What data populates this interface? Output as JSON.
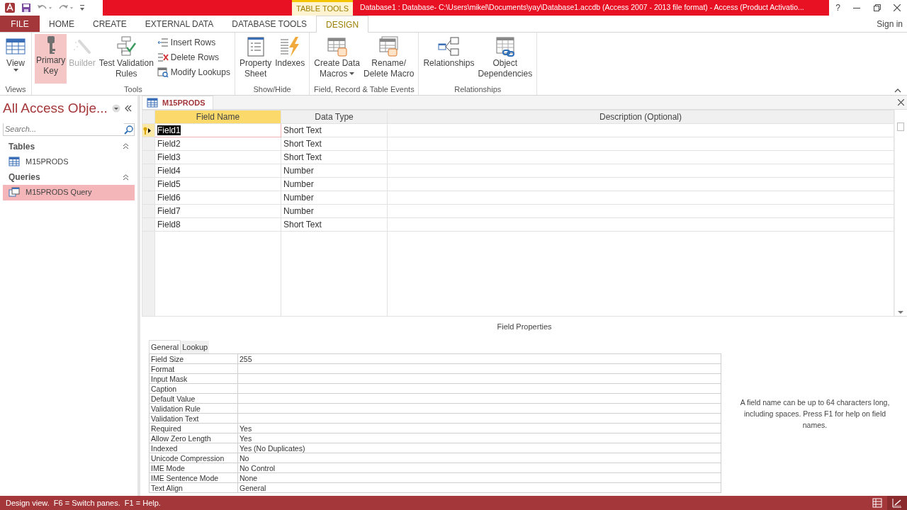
{
  "title_bar": {
    "context_tab": "TABLE TOOLS",
    "title": "Database1 : Database- C:\\Users\\mikel\\Documents\\yay\\Database1.accdb (Access 2007 - 2013 file format) -  Access (Product Activatio...",
    "help": "?"
  },
  "ribbon_tabs": [
    {
      "label": "FILE",
      "kind": "file",
      "selected": false
    },
    {
      "label": "HOME",
      "kind": "tab",
      "selected": false
    },
    {
      "label": "CREATE",
      "kind": "tab",
      "selected": false
    },
    {
      "label": "EXTERNAL DATA",
      "kind": "tab",
      "selected": false
    },
    {
      "label": "DATABASE TOOLS",
      "kind": "tab",
      "selected": false
    },
    {
      "label": "DESIGN",
      "kind": "tab",
      "selected": true
    }
  ],
  "account": "Sign in",
  "ribbon_groups": [
    {
      "label": "Views",
      "buttons": [
        {
          "kind": "large",
          "label": [
            "View"
          ],
          "dropdown": true,
          "selected": false,
          "disabled": false
        }
      ]
    },
    {
      "label": "Tools",
      "buttons": [
        {
          "kind": "large",
          "label": [
            "Primary",
            "Key"
          ],
          "dropdown": false,
          "selected": true,
          "disabled": false
        },
        {
          "kind": "large",
          "label": [
            "Builder"
          ],
          "dropdown": false,
          "selected": false,
          "disabled": true
        },
        {
          "kind": "large",
          "label": [
            "Test Validation",
            "Rules"
          ],
          "dropdown": false,
          "selected": false,
          "disabled": false
        },
        {
          "kind": "small",
          "label": [
            "Insert Rows"
          ]
        },
        {
          "kind": "small",
          "label": [
            "Delete Rows"
          ]
        },
        {
          "kind": "small",
          "label": [
            "Modify Lookups"
          ]
        }
      ]
    },
    {
      "label": "Show/Hide",
      "buttons": [
        {
          "kind": "large",
          "label": [
            "Property",
            "Sheet"
          ],
          "dropdown": false,
          "selected": false,
          "disabled": false
        },
        {
          "kind": "large",
          "label": [
            "Indexes"
          ],
          "dropdown": false,
          "selected": false,
          "disabled": false
        }
      ]
    },
    {
      "label": "Field, Record & Table Events",
      "buttons": [
        {
          "kind": "large",
          "label": [
            "Create Data",
            "Macros"
          ],
          "dropdown": true,
          "selected": false,
          "disabled": false
        },
        {
          "kind": "large",
          "label": [
            "Rename/",
            "Delete Macro"
          ],
          "dropdown": false,
          "selected": false,
          "disabled": false
        }
      ]
    },
    {
      "label": "Relationships",
      "buttons": [
        {
          "kind": "large",
          "label": [
            "Relationships"
          ],
          "dropdown": false,
          "selected": false,
          "disabled": false
        },
        {
          "kind": "large",
          "label": [
            "Object",
            "Dependencies"
          ],
          "dropdown": false,
          "selected": false,
          "disabled": false
        }
      ]
    }
  ],
  "navigation_pane": {
    "title": "All Access Obje...",
    "search": {
      "placeholder": "Search..."
    },
    "sections": [
      {
        "title": "Tables",
        "items": [
          {
            "label": "M15PRODS",
            "kind": "table",
            "selected": false
          }
        ]
      },
      {
        "title": "Queries",
        "items": [
          {
            "label": "M15PRODS Query",
            "kind": "query",
            "selected": true
          }
        ]
      }
    ]
  },
  "document_tab": {
    "label": "M15PRODS"
  },
  "table_design": {
    "columns": [
      {
        "label": "Field Name",
        "selected": true
      },
      {
        "label": "Data Type",
        "selected": false
      },
      {
        "label": "Description (Optional)",
        "selected": false
      }
    ],
    "rows": [
      {
        "field_name": "Field1",
        "data_type": "Short Text",
        "primary_key": true,
        "selected": true
      },
      {
        "field_name": "Field2",
        "data_type": "Short Text",
        "primary_key": false,
        "selected": false
      },
      {
        "field_name": "Field3",
        "data_type": "Short Text",
        "primary_key": false,
        "selected": false
      },
      {
        "field_name": "Field4",
        "data_type": "Number",
        "primary_key": false,
        "selected": false
      },
      {
        "field_name": "Field5",
        "data_type": "Number",
        "primary_key": false,
        "selected": false
      },
      {
        "field_name": "Field6",
        "data_type": "Number",
        "primary_key": false,
        "selected": false
      },
      {
        "field_name": "Field7",
        "data_type": "Number",
        "primary_key": false,
        "selected": false
      },
      {
        "field_name": "Field8",
        "data_type": "Short Text",
        "primary_key": false,
        "selected": false
      }
    ]
  },
  "field_properties": {
    "title": "Field Properties",
    "tabs": [
      {
        "label": "General",
        "selected": true
      },
      {
        "label": "Lookup",
        "selected": false
      }
    ],
    "properties": [
      {
        "label": "Field Size",
        "value": "255"
      },
      {
        "label": "Format"
      },
      {
        "label": "Input Mask"
      },
      {
        "label": "Caption"
      },
      {
        "label": "Default Value"
      },
      {
        "label": "Validation Rule"
      },
      {
        "label": "Validation Text"
      },
      {
        "label": "Required",
        "value": "Yes"
      },
      {
        "label": "Allow Zero Length",
        "value": "Yes"
      },
      {
        "label": "Indexed",
        "value": "Yes (No Duplicates)"
      },
      {
        "label": "Unicode Compression",
        "value": "No"
      },
      {
        "label": "IME Mode",
        "value": "No Control"
      },
      {
        "label": "IME Sentence Mode",
        "value": "None"
      },
      {
        "label": "Text Align",
        "value": "General"
      }
    ],
    "help_text": "A field name can be up to 64 characters long, including spaces. Press F1 for help on field names."
  },
  "status_bar": {
    "text": "Design view.  F6 = Switch panes.  F1 = Help.",
    "views": [
      {
        "kind": "datasheet",
        "selected": false
      },
      {
        "kind": "design",
        "selected": true
      }
    ]
  }
}
